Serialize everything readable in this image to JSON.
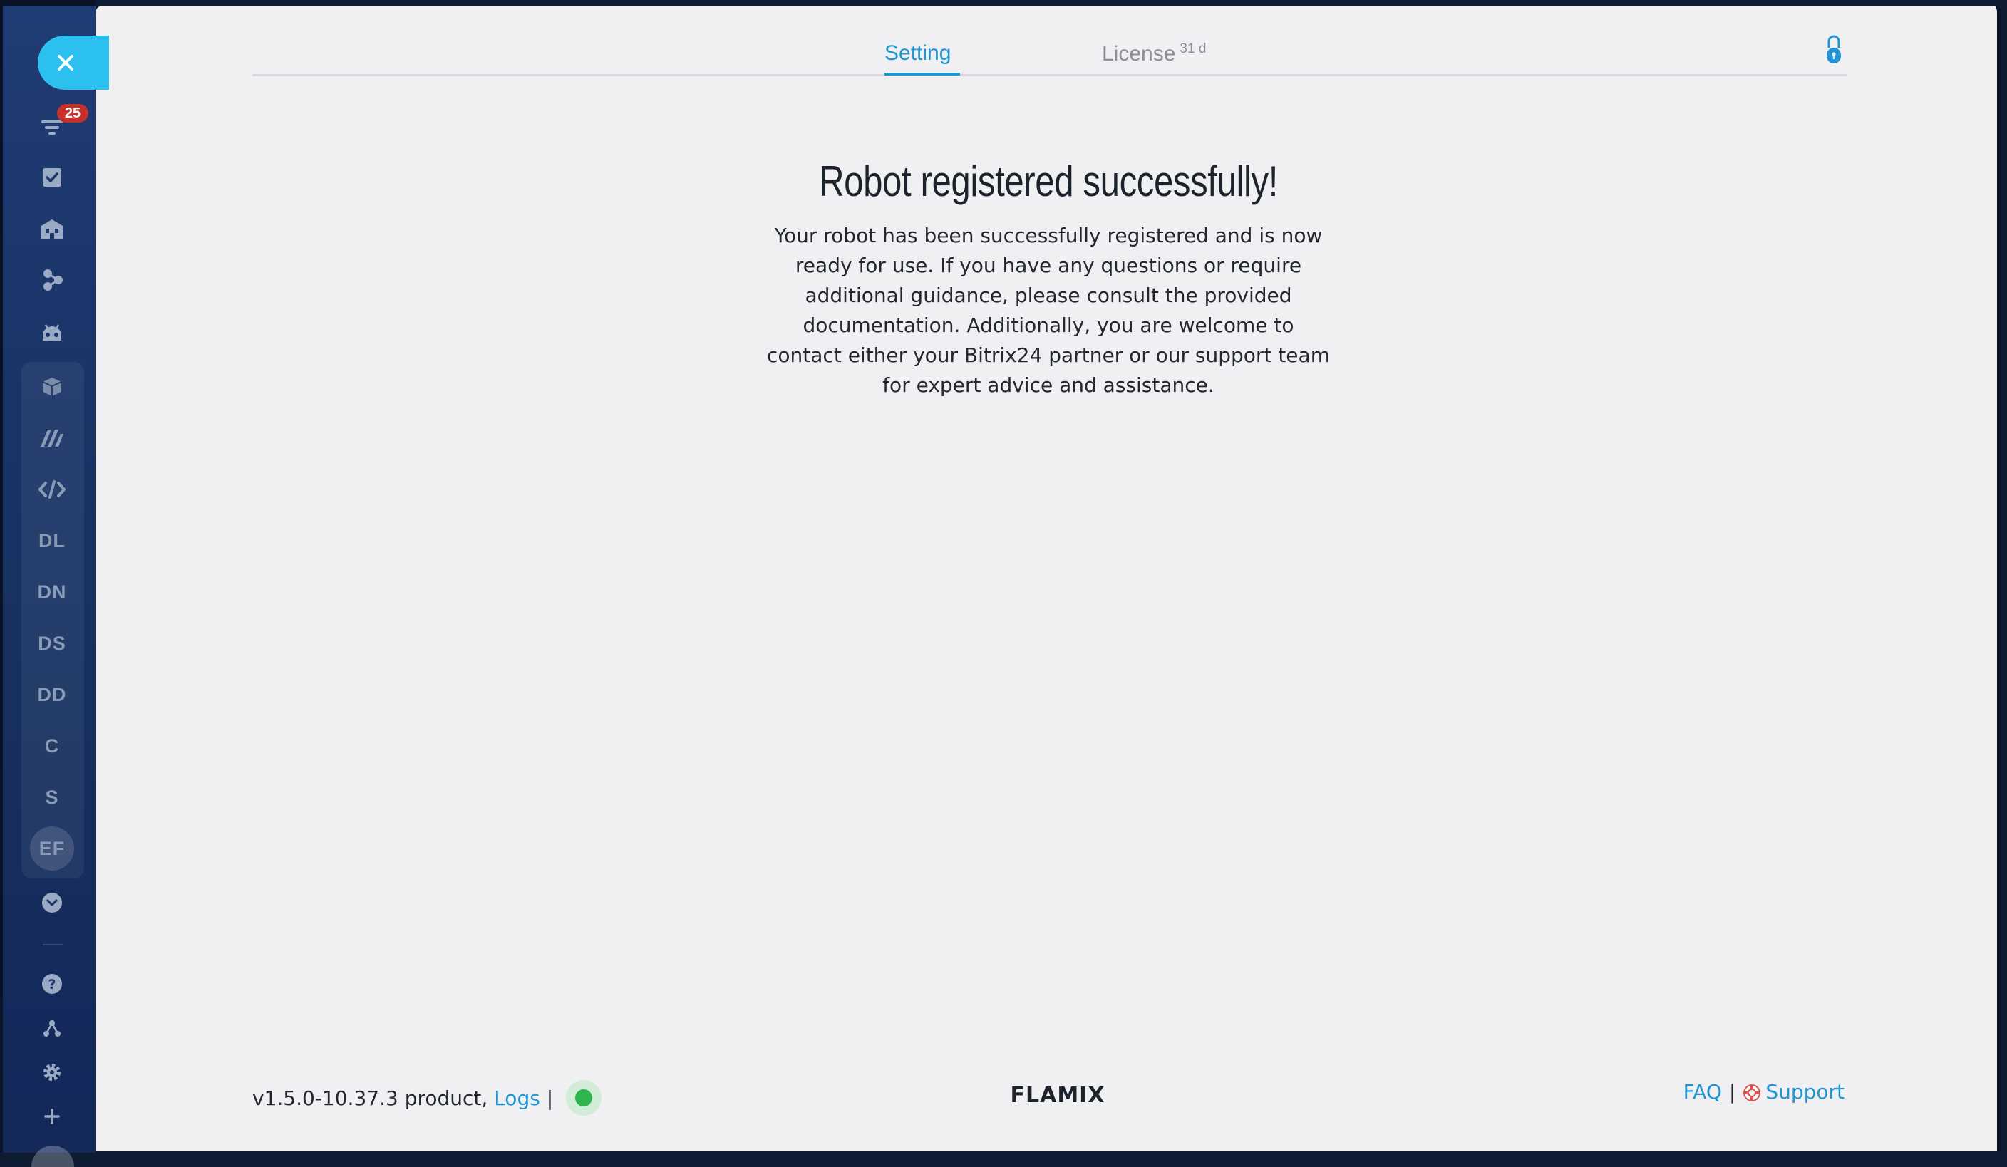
{
  "sidebar": {
    "close_icon": "close-icon",
    "notification_badge": "25",
    "icons": [
      "filter-icon",
      "tasks-icon",
      "company-icon",
      "workflow-icon",
      "robot-icon",
      "box-icon",
      "marketplace-icon",
      "code-icon",
      "chevron-down-icon",
      "help-icon",
      "sitemap-icon",
      "gear-icon",
      "plus-icon"
    ],
    "items": [
      {
        "label": "DL"
      },
      {
        "label": "DN"
      },
      {
        "label": "DS"
      },
      {
        "label": "DD"
      },
      {
        "label": "C"
      },
      {
        "label": "S"
      },
      {
        "label": "EF"
      }
    ]
  },
  "tabs": {
    "setting": "Setting",
    "license": "License",
    "license_days": "31 d"
  },
  "main": {
    "title": "Robot registered successfully!",
    "message": "Your robot has been successfully registered and is now\nready for use. If you have any questions or require\nadditional guidance, please consult the provided\ndocumentation. Additionally, you are welcome to\ncontact either your Bitrix24 partner or our support team\nfor expert advice and assistance."
  },
  "footer": {
    "version": "v1.5.0-10.37.3 product,",
    "logs_label": "Logs",
    "separator": "|",
    "logo": "FLAMIX",
    "faq_label": "FAQ",
    "support_label": "Support"
  },
  "colors": {
    "accent": "#1f96d3",
    "status_ok": "#2fb44e",
    "close_button": "#2cc0ef",
    "badge": "#c62f2a"
  }
}
